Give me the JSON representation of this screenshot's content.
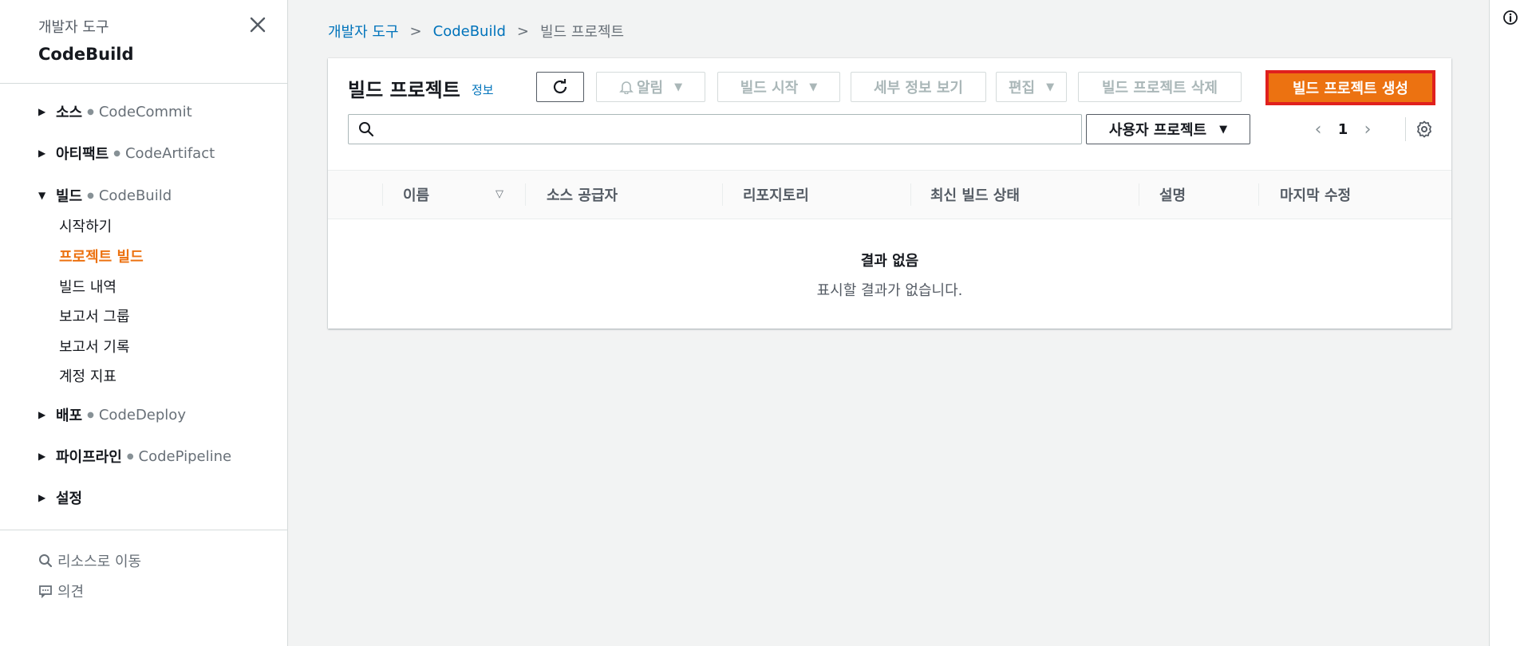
{
  "sidebar": {
    "parent": "개발자 도구",
    "title": "CodeBuild",
    "sections": [
      {
        "name": "소스",
        "service": "CodeCommit",
        "expanded": false
      },
      {
        "name": "아티팩트",
        "service": "CodeArtifact",
        "expanded": false
      },
      {
        "name": "빌드",
        "service": "CodeBuild",
        "expanded": true
      },
      {
        "name": "배포",
        "service": "CodeDeploy",
        "expanded": false
      },
      {
        "name": "파이프라인",
        "service": "CodePipeline",
        "expanded": false
      },
      {
        "name": "설정",
        "service": "",
        "expanded": false
      }
    ],
    "build_links": [
      "시작하기",
      "프로젝트 빌드",
      "빌드 내역",
      "보고서 그룹",
      "보고서 기록",
      "계정 지표"
    ],
    "active_link": "프로젝트 빌드",
    "footer": {
      "goto_resource": "리소스로 이동",
      "feedback": "의견"
    }
  },
  "breadcrumb": [
    "개발자 도구",
    "CodeBuild",
    "빌드 프로젝트"
  ],
  "panel": {
    "title": "빌드 프로젝트",
    "info": "정보",
    "buttons": {
      "notify": "알림",
      "start_build": "빌드 시작",
      "view_details": "세부 정보 보기",
      "edit": "편집",
      "delete": "빌드 프로젝트 삭제",
      "create": "빌드 프로젝트 생성"
    },
    "search": {
      "value": "",
      "placeholder": ""
    },
    "filter": "사용자 프로젝트",
    "page": "1",
    "columns": [
      "이름",
      "소스 공급자",
      "리포지토리",
      "최신 빌드 상태",
      "설명",
      "마지막 수정"
    ],
    "empty_title": "결과 없음",
    "empty_message": "표시할 결과가 없습니다."
  },
  "colors": {
    "accent": "#ec7211",
    "link": "#0073bb",
    "highlight_border": "#e0201d"
  }
}
